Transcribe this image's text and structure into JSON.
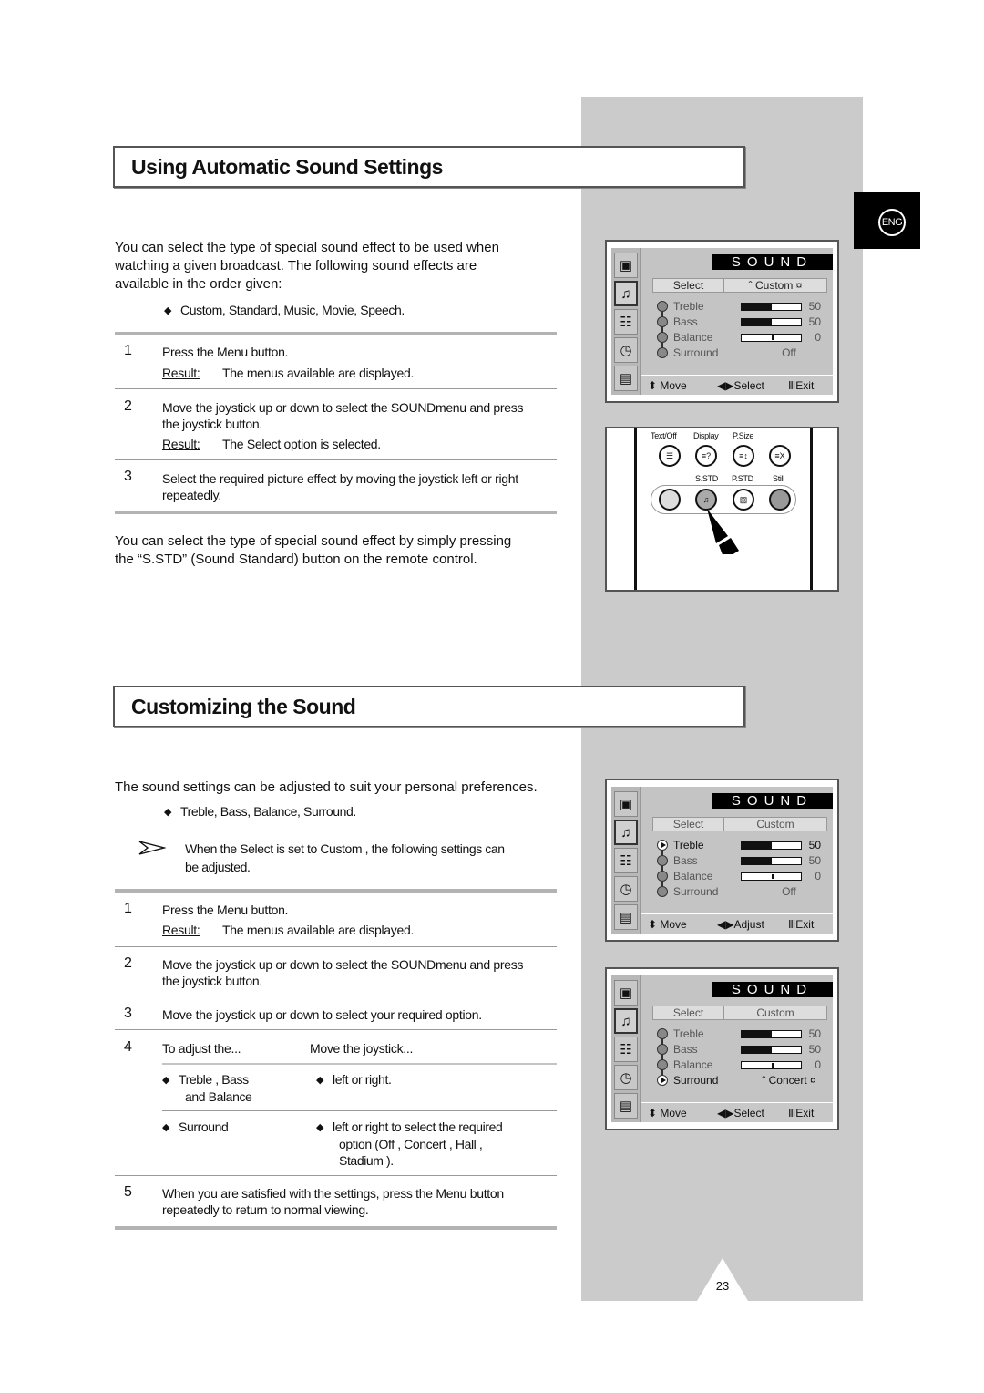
{
  "language_tab": "ENG",
  "page_number": "23",
  "section1": {
    "title": "Using Automatic Sound Settings",
    "intro": [
      "You can select the type of special sound effect to be used when",
      "watching a given broadcast. The following sound effects are",
      "available in the order given:"
    ],
    "bullet": "Custom, Standard, Music, Movie, Speech.",
    "steps": [
      {
        "num": "1",
        "text": [
          "Press the Menu  button."
        ],
        "result_label": "Result:",
        "result": "The menus available are displayed."
      },
      {
        "num": "2",
        "text": [
          "Move the joystick up or down to select the SOUNDmenu and press",
          "the joystick button."
        ],
        "result_label": "Result:",
        "result": "The Select    option is selected."
      },
      {
        "num": "3",
        "text": [
          "Select the required picture effect by moving the joystick left or right",
          "repeatedly."
        ]
      }
    ],
    "outro": [
      "You can select the type of special sound effect by simply pressing",
      "the “S.STD” (Sound Standard) button on the remote control."
    ]
  },
  "section2": {
    "title": "Customizing the Sound",
    "intro": "The sound settings can be adjusted to suit your personal preferences.",
    "bullet": "Treble, Bass, Balance, Surround.",
    "note": [
      "When the Select    is set to Custom , the following settings can",
      "be adjusted."
    ],
    "steps": [
      {
        "num": "1",
        "text": [
          "Press the Menu  button."
        ],
        "result_label": "Result:",
        "result": "The menus available are displayed."
      },
      {
        "num": "2",
        "text": [
          "Move the joystick up or down to select the SOUNDmenu and press",
          "the joystick button."
        ]
      },
      {
        "num": "3",
        "text": [
          "Move the joystick up or down to select your required option."
        ]
      },
      {
        "num": "4",
        "col1_header": "To adjust the...",
        "col2_header": "Move the joystick...",
        "rows": [
          {
            "item": [
              "Treble    , Bass",
              "and Balance"
            ],
            "action": [
              "left or right."
            ]
          },
          {
            "item": [
              "Surround"
            ],
            "action": [
              "left or right to select the required",
              "option (Off  , Concert   , Hall   ,",
              "Stadium  )."
            ]
          }
        ]
      },
      {
        "num": "5",
        "text": [
          "When you are satisfied with the settings, press the Menu  button",
          "repeatedly to return to normal viewing."
        ]
      }
    ]
  },
  "osd_screens": [
    {
      "title": "SOUND",
      "select_label": "Select",
      "select_value": "ˆ  Custom ¤",
      "rows": [
        {
          "name": "Treble",
          "value": "50",
          "level": 0.5,
          "type": "bar"
        },
        {
          "name": "Bass",
          "value": "50",
          "level": 0.5,
          "type": "bar"
        },
        {
          "name": "Balance",
          "value": "0",
          "level": 0,
          "type": "balance"
        },
        {
          "name": "Surround",
          "value": "Off",
          "type": "option"
        }
      ],
      "highlight": "select",
      "footer": {
        "move": "⬍ Move",
        "action": "◀▶Select",
        "exit": "ⅢExit"
      }
    },
    {
      "title": "SOUND",
      "select_label": "Select",
      "select_value": "Custom",
      "rows": [
        {
          "name": "Treble",
          "value": "50",
          "level": 0.5,
          "type": "bar"
        },
        {
          "name": "Bass",
          "value": "50",
          "level": 0.5,
          "type": "bar"
        },
        {
          "name": "Balance",
          "value": "0",
          "level": 0,
          "type": "balance"
        },
        {
          "name": "Surround",
          "value": "Off",
          "type": "option"
        }
      ],
      "highlight": "Treble",
      "footer": {
        "move": "⬍ Move",
        "action": "◀▶Adjust",
        "exit": "ⅢExit"
      }
    },
    {
      "title": "SOUND",
      "select_label": "Select",
      "select_value": "Custom",
      "rows": [
        {
          "name": "Treble",
          "value": "50",
          "level": 0.5,
          "type": "bar"
        },
        {
          "name": "Bass",
          "value": "50",
          "level": 0.5,
          "type": "bar"
        },
        {
          "name": "Balance",
          "value": "0",
          "level": 0,
          "type": "balance"
        },
        {
          "name": "Surround",
          "value": "ˆ  Concert ¤",
          "type": "option"
        }
      ],
      "highlight": "Surround",
      "footer": {
        "move": "⬍ Move",
        "action": "◀▶Select",
        "exit": "ⅢExit"
      }
    }
  ],
  "osd_menu_icons": [
    "picture-icon",
    "sound-icon",
    "function-icon",
    "timer-icon",
    "teletext-icon"
  ],
  "remote": {
    "top_labels": [
      "Text/Off",
      "Display",
      "P.Size"
    ],
    "bottom_labels": [
      "S.STD",
      "P.STD",
      "Still"
    ],
    "top_buttons": [
      "☰",
      "≡?",
      "≡↕",
      "≡X"
    ],
    "bottom_buttons": [
      "",
      "♫",
      "▧",
      ""
    ]
  }
}
